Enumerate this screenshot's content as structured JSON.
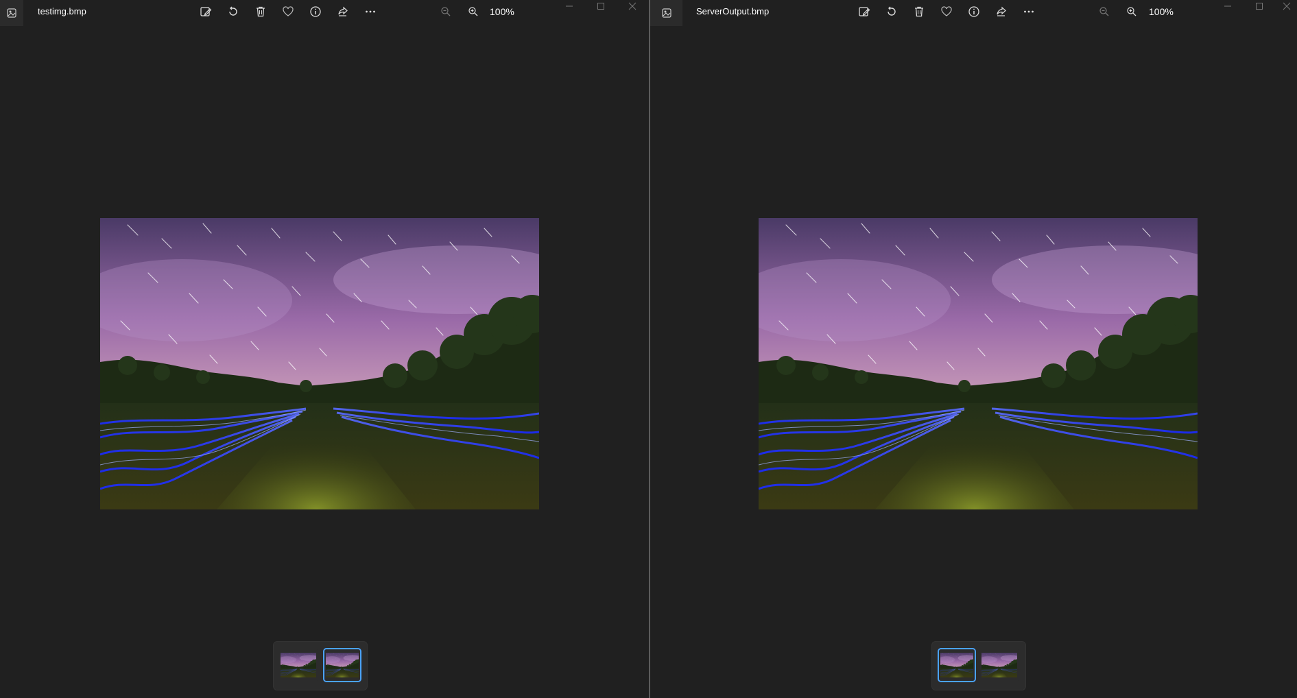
{
  "windows": [
    {
      "title": "testimg.bmp",
      "zoom": "100%",
      "selected_thumbnail": 2
    },
    {
      "title": "ServerOutput.bmp",
      "zoom": "100%",
      "selected_thumbnail": 1
    }
  ],
  "icons": {
    "app": "photos-app-icon",
    "toolbar": [
      "edit-image-icon",
      "rotate-icon",
      "delete-icon",
      "favorite-icon",
      "info-icon",
      "share-icon",
      "more-icon"
    ],
    "zoom_out": "zoom-out-icon",
    "zoom_in": "zoom-in-icon",
    "caption": [
      "minimize-icon",
      "maximize-icon",
      "close-icon"
    ]
  },
  "colors": {
    "background": "#202020",
    "accent": "#4aa3ff",
    "divider": "#5c5c5c"
  }
}
